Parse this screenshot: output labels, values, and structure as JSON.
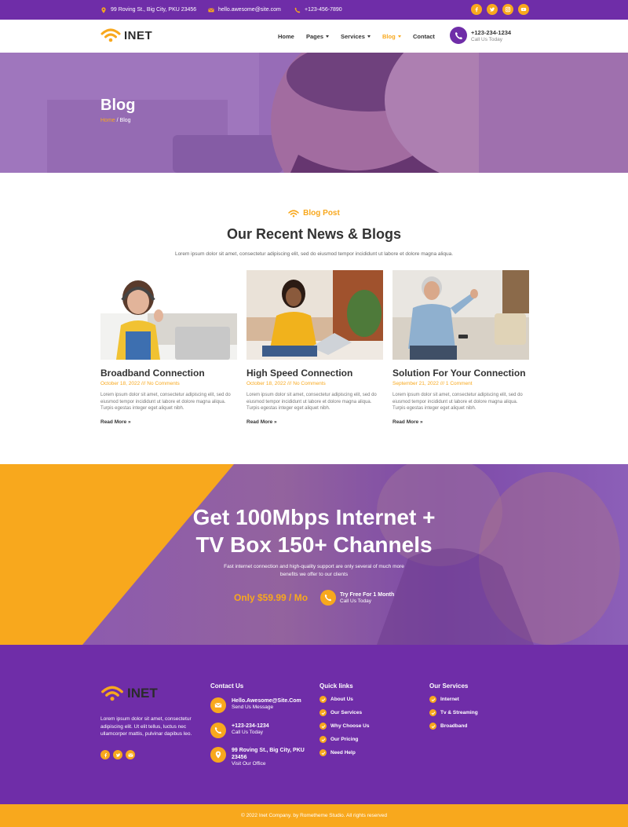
{
  "topbar": {
    "address": "99 Roving St., Big City, PKU 23456",
    "email": "hello.awesome@site.com",
    "phone": "+123-456-7890",
    "social": [
      "facebook-icon",
      "twitter-icon",
      "instagram-icon",
      "youtube-icon"
    ]
  },
  "header": {
    "logo": "INET",
    "nav": [
      {
        "label": "Home"
      },
      {
        "label": "Pages"
      },
      {
        "label": "Services"
      },
      {
        "label": "Blog"
      },
      {
        "label": "Contact"
      }
    ],
    "call_number": "+123-234-1234",
    "call_label": "Call Us Today"
  },
  "hero": {
    "title": "Blog",
    "crumb_home": "Home",
    "crumb_sep": " / ",
    "crumb_current": "Blog"
  },
  "blog": {
    "kicker": "Blog Post",
    "title": "Our Recent News & Blogs",
    "subtitle": "Lorem ipsum dolor sit amet, consectetur adipiscing elit, sed do eiusmod tempor incididunt ut labore et dolore magna aliqua.",
    "cards": [
      {
        "title": "Broadband Connection",
        "meta": "October 18, 2022 /// No Comments",
        "text": "Lorem ipsum dolor sit amet, consectetur adipiscing elit, sed do eiusmod tempor incididunt ut labore et dolore magna aliqua. Turpis egestas integer eget aliquet nibh.",
        "more": "Read More »"
      },
      {
        "title": "High Speed Connection",
        "meta": "October 18, 2022 /// No Comments",
        "text": "Lorem ipsum dolor sit amet, consectetur adipiscing elit, sed do eiusmod tempor incididunt ut labore et dolore magna aliqua. Turpis egestas integer eget aliquet nibh.",
        "more": "Read More »"
      },
      {
        "title": "Solution For Your Connection",
        "meta": "September 21, 2022 /// 1 Comment",
        "text": "Lorem ipsum dolor sit amet, consectetur adipiscing elit, sed do eiusmod tempor incididunt ut labore et dolore magna aliqua. Turpis egestas integer eget aliquet nibh.",
        "more": "Read More »"
      }
    ]
  },
  "promo": {
    "line1": "Get 100Mbps Internet +",
    "line2": "TV Box 150+ Channels",
    "subtitle": "Fast internet connection and high-quality support are only several of much more benefits we offer to our clients",
    "price": "Only $59.99 / Mo",
    "try_title": "Try Free For 1 Month",
    "try_sub": "Call Us Today"
  },
  "footer": {
    "logo": "INET",
    "desc": "Lorem ipsum dolor sit amet, consectetur adipiscing elit. Ut elit tellus, luctus nec ullamcorper mattis, pulvinar dapibus leo.",
    "contact_heading": "Contact Us",
    "contacts": [
      {
        "value": "Hello.Awesome@Site.Com",
        "label": "Send Us Message"
      },
      {
        "value": "+123-234-1234",
        "label": "Call Us Today"
      },
      {
        "value": "99 Roving St., Big City, PKU 23456",
        "label": "Visit Our Office"
      }
    ],
    "quick_heading": "Quick links",
    "quick": [
      "About Us",
      "Our Services",
      "Why Choose Us",
      "Our Pricing",
      "Need Help"
    ],
    "services_heading": "Our Services",
    "services": [
      "Internet",
      "Tv & Streaming",
      "Broadband"
    ],
    "copyright": "© 2022 Inet Company. by Rometheme Studio. All rights reserved"
  },
  "colors": {
    "purple": "#6f2da8",
    "orange": "#f8a81d",
    "white": "#ffffff"
  }
}
